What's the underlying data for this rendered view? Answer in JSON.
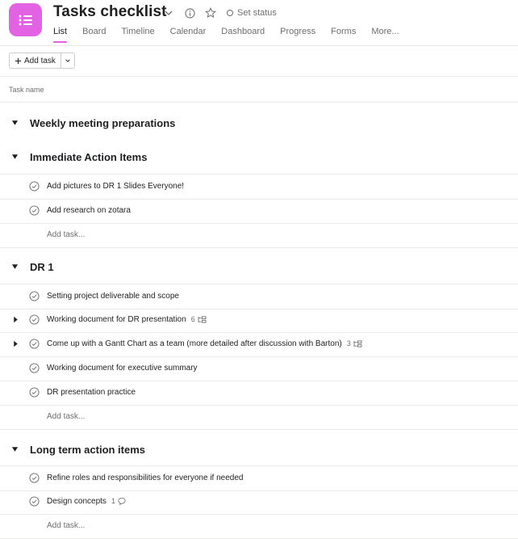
{
  "header": {
    "title": "Tasks checklist",
    "set_status": "Set status",
    "tabs": [
      "List",
      "Board",
      "Timeline",
      "Calendar",
      "Dashboard",
      "Progress",
      "Forms",
      "More..."
    ],
    "active_tab": "List",
    "accent_color": "#e362e3"
  },
  "toolbar": {
    "add_task_label": "Add task"
  },
  "columns": {
    "task_name": "Task name"
  },
  "sections": [
    {
      "name": "Weekly meeting preparations",
      "tasks": []
    },
    {
      "name": "Immediate Action Items",
      "tasks": [
        {
          "name": "Add pictures to DR 1 Slides Everyone!"
        },
        {
          "name": "Add research on zotara"
        }
      ],
      "add_task": "Add task..."
    },
    {
      "name": "DR 1",
      "tasks": [
        {
          "name": "Setting project deliverable and scope"
        },
        {
          "name": "Working document for DR presentation",
          "subtasks": "6"
        },
        {
          "name": "Come up with a Gantt Chart as a team (more detailed after discussion with Barton)",
          "subtasks": "3"
        },
        {
          "name": "Working document for executive summary"
        },
        {
          "name": "DR presentation practice"
        }
      ],
      "add_task": "Add task..."
    },
    {
      "name": "Long term action items",
      "tasks": [
        {
          "name": "Refine roles and responsibilities for everyone if needed"
        },
        {
          "name": "Design concepts",
          "comments": "1"
        }
      ],
      "add_task": "Add task..."
    }
  ]
}
